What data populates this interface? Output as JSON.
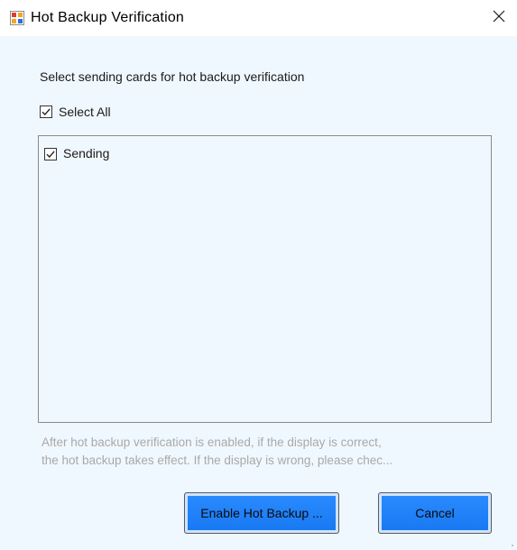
{
  "window": {
    "title": "Hot Backup Verification",
    "icons": {
      "app": "app-window-icon",
      "close": "close-icon"
    }
  },
  "dialog": {
    "instruction": "Select sending cards for hot backup verification",
    "select_all": {
      "label": "Select All",
      "checked": true
    },
    "list": {
      "items": [
        {
          "label": "Sending",
          "checked": true
        }
      ]
    },
    "info_line1": "After hot backup verification is enabled, if the display is correct,",
    "info_line2": "the hot backup takes effect. If the display is wrong, please chec...",
    "buttons": {
      "enable_label": "Enable Hot Backup ...",
      "cancel_label": "Cancel"
    }
  },
  "colors": {
    "client_bg": "#f0f8ff",
    "button_blue": "#1778f2",
    "info_text": "#a9a9a9"
  }
}
